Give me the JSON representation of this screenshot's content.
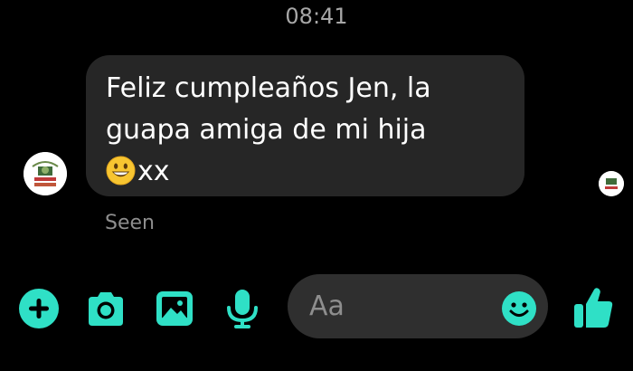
{
  "header": {
    "timestamp": "08:41"
  },
  "message": {
    "lines": [
      "Feliz cumpleaños Jen, la",
      "guapa amiga de mi hija"
    ],
    "trailing_text": "xx",
    "emoji": "grinning-face-emoji",
    "status": "Seen"
  },
  "composer": {
    "placeholder": "Aa"
  },
  "icons": {
    "add": "plus-circle-icon",
    "camera": "camera-icon",
    "gallery": "image-icon",
    "voice": "microphone-icon",
    "emoji": "smiley-icon",
    "like": "thumbs-up-icon"
  },
  "colors": {
    "accent": "#2fe0c6",
    "background": "#000000",
    "bubble": "#262626",
    "composer": "#2f2f2f",
    "muted_text": "#8e8e8e"
  }
}
